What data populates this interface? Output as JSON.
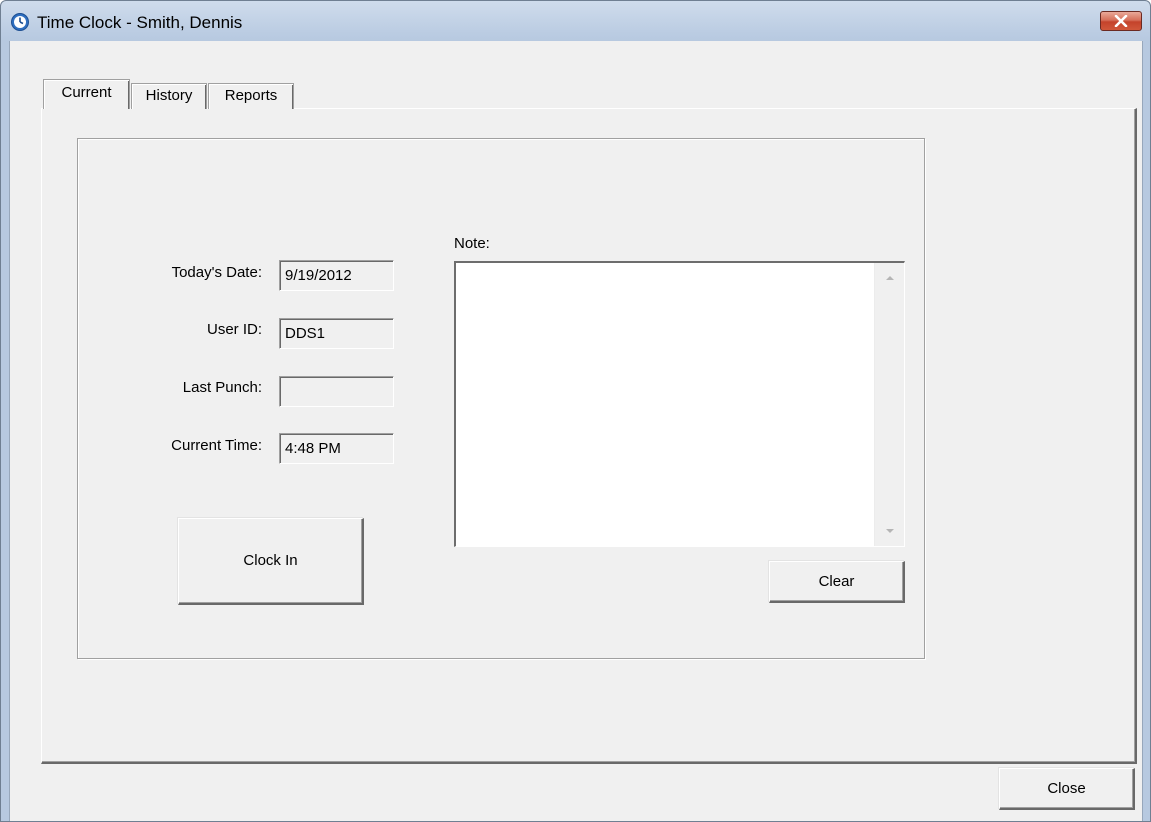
{
  "window": {
    "title": "Time Clock - Smith, Dennis",
    "icon": "clock-icon",
    "close_icon": "close-icon"
  },
  "tabs": [
    {
      "label": "Current",
      "selected": true
    },
    {
      "label": "History",
      "selected": false
    },
    {
      "label": "Reports",
      "selected": false
    }
  ],
  "form": {
    "date_label": "Today's Date:",
    "date_value": "9/19/2012",
    "user_label": "User ID:",
    "user_value": "DDS1",
    "last_punch_label": "Last Punch:",
    "last_punch_value": "",
    "time_label": "Current Time:",
    "time_value": "4:48 PM",
    "note_label": "Note:",
    "note_value": ""
  },
  "buttons": {
    "clock_in": "Clock In",
    "clear": "Clear",
    "close": "Close"
  },
  "colors": {
    "titlebar": "#bccde3",
    "dialog_bg": "#f0f0f0",
    "close_button": "#c4432b",
    "clock_icon": "#2f6fc0"
  }
}
